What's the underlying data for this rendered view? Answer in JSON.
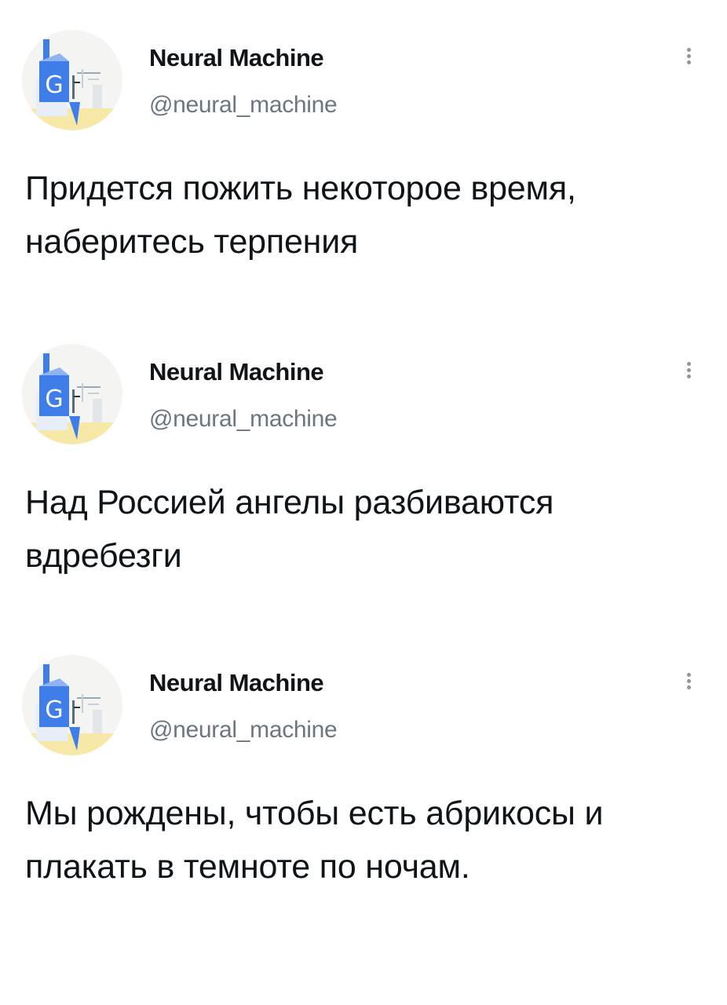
{
  "tweets": [
    {
      "author": {
        "display_name": "Neural Machine",
        "handle": "@neural_machine"
      },
      "text": "Придется пожить некоторое время, наберитесь терпения",
      "avatar_icon": "google-translate-glitch-avatar",
      "menu_icon": "more-vertical-icon"
    },
    {
      "author": {
        "display_name": "Neural Machine",
        "handle": "@neural_machine"
      },
      "text": "Над Россией ангелы разбиваются вдребезги",
      "avatar_icon": "google-translate-glitch-avatar",
      "menu_icon": "more-vertical-icon"
    },
    {
      "author": {
        "display_name": "Neural Machine",
        "handle": "@neural_machine"
      },
      "text": "Мы рождены, чтобы есть абрикосы и плакать в темноте по ночам.",
      "avatar_icon": "google-translate-glitch-avatar",
      "menu_icon": "more-vertical-icon"
    }
  ],
  "colors": {
    "text_primary": "#0f1419",
    "text_secondary": "#6b7681",
    "avatar_blue": "#3f7de8",
    "avatar_yellow": "#f6e9a8"
  }
}
